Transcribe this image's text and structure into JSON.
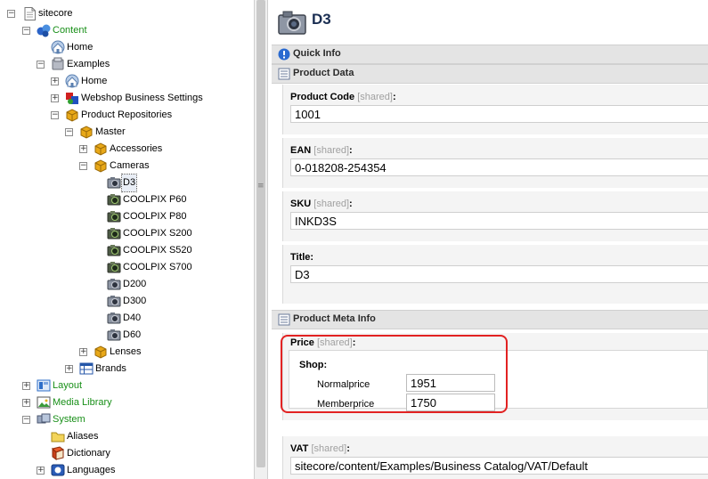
{
  "tree": {
    "root": "sitecore",
    "content": "Content",
    "home_top": "Home",
    "examples": "Examples",
    "home": "Home",
    "webshop": "Webshop Business Settings",
    "product_repos": "Product Repositories",
    "master": "Master",
    "accessories": "Accessories",
    "cameras": "Cameras",
    "cameras_items": [
      "D3",
      "COOLPIX P60",
      "COOLPIX P80",
      "COOLPIX S200",
      "COOLPIX S520",
      "COOLPIX S700",
      "D200",
      "D300",
      "D40",
      "D60"
    ],
    "lenses": "Lenses",
    "brands": "Brands",
    "layout": "Layout",
    "media_library": "Media Library",
    "system": "System",
    "aliases": "Aliases",
    "dictionary": "Dictionary",
    "languages": "Languages"
  },
  "editor": {
    "title": "D3",
    "quick_info": "Quick Info",
    "product_data": "Product Data",
    "product_meta": "Product Meta Info",
    "shared_tag": "[shared]",
    "fields": {
      "product_code": {
        "label": "Product Code",
        "value": "1001"
      },
      "ean": {
        "label": "EAN",
        "value": "0-018208-254354"
      },
      "sku": {
        "label": "SKU",
        "value": "INKD3S"
      },
      "title": {
        "label": "Title:",
        "value": "D3"
      },
      "price": {
        "label": "Price"
      },
      "vat": {
        "label": "VAT",
        "value": "sitecore/content/Examples/Business Catalog/VAT/Default"
      }
    },
    "price": {
      "shop_label": "Shop:",
      "normal_label": "Normalprice",
      "normal_value": "1951",
      "member_label": "Memberprice",
      "member_value": "1750"
    }
  },
  "colors": {
    "green_label": "#188f18",
    "highlight": "#e22222",
    "title": "#1a2e52"
  }
}
